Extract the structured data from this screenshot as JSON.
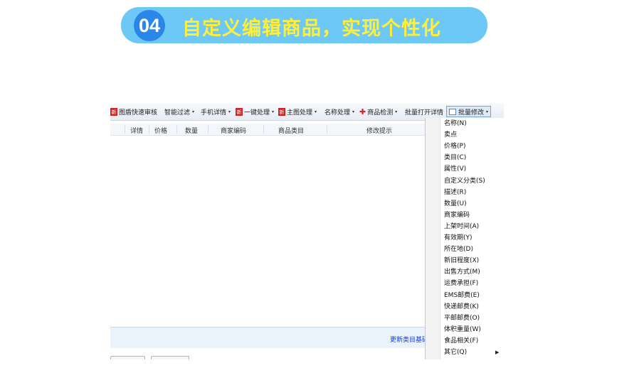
{
  "banner": {
    "number": "04",
    "title": "自定义编辑商品，实现个性化"
  },
  "toolbar": {
    "items": [
      {
        "label": "图盾快速审核",
        "icon": "new-icon",
        "icon_text": "新",
        "caret": false
      },
      {
        "label": "智能过滤",
        "caret": true
      },
      {
        "label": "手机详情",
        "caret": true
      },
      {
        "label": "一键处理",
        "icon": "new-icon",
        "icon_text": "新",
        "caret": true
      },
      {
        "label": "主图处理",
        "icon": "new-icon",
        "icon_text": "新",
        "caret": true
      },
      {
        "label": "名称处理",
        "caret": true
      },
      {
        "label": "商品检测",
        "icon": "red-cross-icon",
        "caret": true
      },
      {
        "label": "批量打开详情",
        "caret": false
      },
      {
        "label": "批量修改",
        "icon": "grid-icon",
        "caret": true,
        "pressed": true
      }
    ],
    "caret_glyph": "▾"
  },
  "table": {
    "columns": [
      "详情",
      "价格",
      "数量",
      "商家编码",
      "商品类目",
      "修改提示"
    ]
  },
  "status": {
    "link": "更新类目基础"
  },
  "menu": {
    "items": [
      "名称(N)",
      "卖点",
      "价格(P)",
      "类目(C)",
      "属性(V)",
      "自定义分类(S)",
      "描述(R)",
      "数量(U)",
      "商家编码",
      "上架时间(A)",
      "有效期(Y)",
      "所在地(D)",
      "新旧程度(X)",
      "出售方式(M)",
      "运费承担(F)",
      "EMS邮费(E)",
      "快递邮费(K)",
      "平邮邮费(O)",
      "体积重量(W)",
      "食品相关(F)",
      "其它(Q)"
    ],
    "submenu_arrow": "▶"
  },
  "colors": {
    "banner_bg": "#6dc8f5",
    "banner_badge": "#2a86e8",
    "banner_text": "#ffee3a",
    "link": "#1a3fd0"
  }
}
